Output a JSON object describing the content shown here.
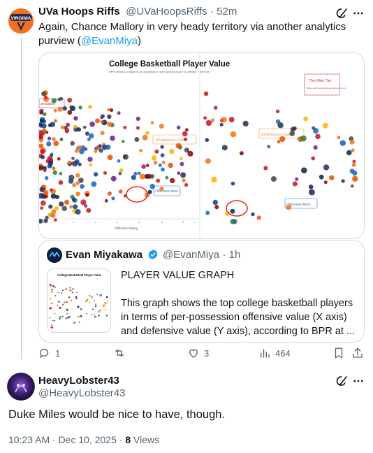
{
  "post": {
    "author_name": "UVa Hoops Riffs",
    "author_handle": "@UVaHoopsRiffs",
    "time": "· 52m",
    "text_prefix": "Again, Chance Mallory in very heady territory via another analytics purview (",
    "mention": "@EvanMiya",
    "text_suffix": ")",
    "avatar_text": "VIRGINIA",
    "chart": {
      "title": "College Basketball Player Value",
      "subtitle": "BPR predicts a player's per-possession value going forward on offense + defense",
      "x_axis_label": "Offensive Rating",
      "specialists_label": "pecialists",
      "allamerican_label_left": "All-American Caliber",
      "offensive_aces_left": "Offensive Aces",
      "elite_tier": "The Elite Tier",
      "elite_sub": "Biases and backlinking way above the rest",
      "allamerican_label_right": "All-American Caliber",
      "offensive_aces_right": "Offensive Aces",
      "x_ticks": [
        "0",
        "1",
        "2",
        "3",
        "4",
        "5",
        "6",
        "7"
      ]
    },
    "quote": {
      "author_name": "Evan Miyakawa",
      "author_handle": "@EvanMiya",
      "time": "· 1h",
      "thumb_title": "College Basketball Player Value",
      "line1": "PLAYER VALUE GRAPH",
      "line2": "This graph shows the top college basketball players in terms of per-possession offensive value (X axis) and defensive value (Y axis), according to BPR at ..."
    },
    "actions": {
      "replies": "1",
      "reposts": "",
      "likes": "3",
      "views": "464"
    }
  },
  "reply": {
    "author_name": "HeavyLobster43",
    "author_handle": "@HeavyLobster43",
    "text": "Duke Miles would be nice to have, though.",
    "timestamp": "10:23 AM · Dec 10, 2025 · ",
    "views_count": "8",
    "views_label": " Views"
  },
  "colors": {
    "accent": "#1d9bf0",
    "text": "#0f1419",
    "muted": "#536471",
    "border": "#cfd9de",
    "grok": "#000000",
    "circle_red": "#e8281a"
  }
}
